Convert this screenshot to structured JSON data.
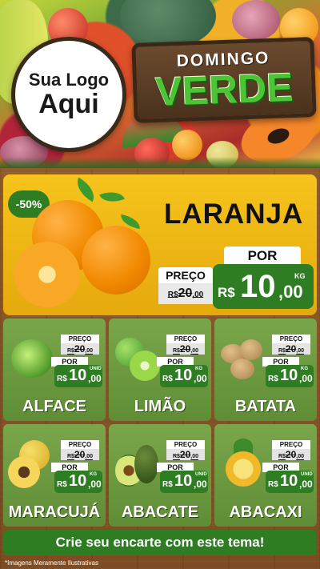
{
  "header": {
    "logo_line1": "Sua Logo",
    "logo_line2": "Aqui",
    "title_top": "DOMINGO",
    "title_main": "VERDE"
  },
  "featured": {
    "discount": "-50%",
    "name": "LARANJA",
    "old_label": "PREÇO",
    "old_currency": "R$",
    "old_int": "20",
    "old_dec": ",00",
    "new_label": "POR",
    "new_currency": "R$",
    "new_int": "10",
    "new_dec": ",00",
    "unit": "KG"
  },
  "products": [
    {
      "name": "ALFACE",
      "old_label": "PREÇO",
      "old_currency": "R$",
      "old_int": "20",
      "old_dec": ",00",
      "new_label": "POR",
      "new_currency": "R$",
      "new_int": "10",
      "new_dec": ",00",
      "unit": "UNID"
    },
    {
      "name": "LIMÃO",
      "old_label": "PREÇO",
      "old_currency": "R$",
      "old_int": "20",
      "old_dec": ",00",
      "new_label": "POR",
      "new_currency": "R$",
      "new_int": "10",
      "new_dec": ",00",
      "unit": "KG"
    },
    {
      "name": "BATATA",
      "old_label": "PREÇO",
      "old_currency": "R$",
      "old_int": "20",
      "old_dec": ",00",
      "new_label": "POR",
      "new_currency": "R$",
      "new_int": "10",
      "new_dec": ",00",
      "unit": "KG"
    },
    {
      "name": "MARACUJÁ",
      "old_label": "PREÇO",
      "old_currency": "R$",
      "old_int": "20",
      "old_dec": ",00",
      "new_label": "POR",
      "new_currency": "R$",
      "new_int": "10",
      "new_dec": ",00",
      "unit": "KG"
    },
    {
      "name": "ABACATE",
      "old_label": "PREÇO",
      "old_currency": "R$",
      "old_int": "20",
      "old_dec": ",00",
      "new_label": "POR",
      "new_currency": "R$",
      "new_int": "10",
      "new_dec": ",00",
      "unit": "UNID"
    },
    {
      "name": "ABACAXI",
      "old_label": "PREÇO",
      "old_currency": "R$",
      "old_int": "20",
      "old_dec": ",00",
      "new_label": "POR",
      "new_currency": "R$",
      "new_int": "10",
      "new_dec": ",00",
      "unit": "UNID"
    }
  ],
  "cta_label": "Crie seu encarte com este tema!",
  "footnote": "*Imagens Meramente Ilustrativas",
  "icons": {
    "featured": "orange-icon",
    "products": [
      "lettuce-icon",
      "lime-icon",
      "potato-icon",
      "passion-fruit-icon",
      "avocado-icon",
      "pineapple-icon"
    ]
  },
  "colors": {
    "accent_green": "#2e7d23",
    "title_green": "#4cc436",
    "featured_bg": "#f6c41c",
    "card_bg": "#7aa64b"
  }
}
